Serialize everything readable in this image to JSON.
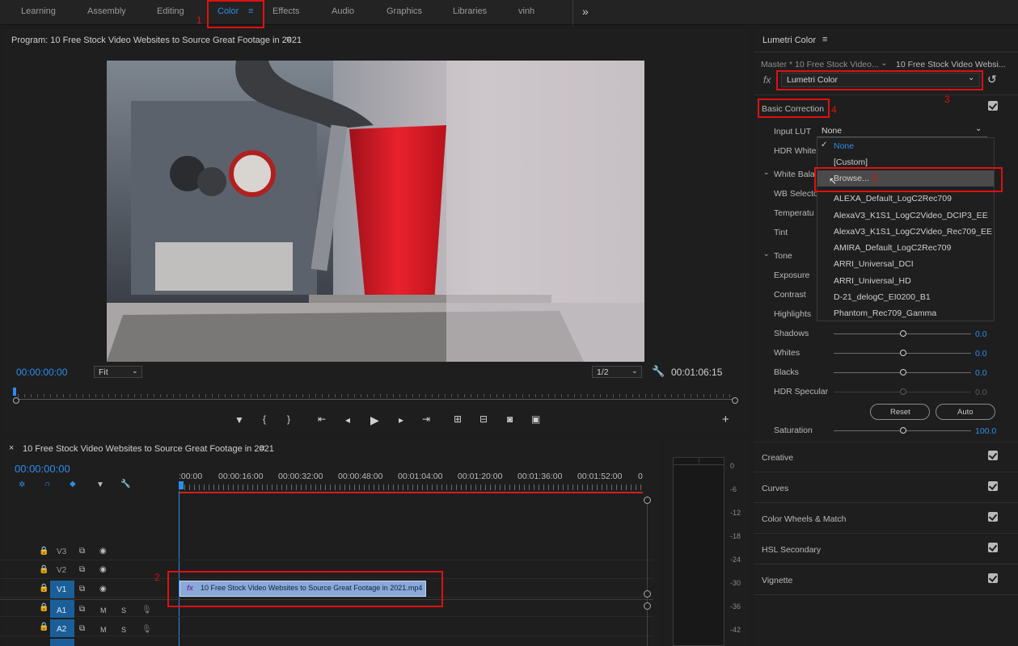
{
  "workspaces": [
    "Learning",
    "Assembly",
    "Editing",
    "Color",
    "Effects",
    "Audio",
    "Graphics",
    "Libraries",
    "vinh"
  ],
  "workspace_more": "»",
  "menu_glyph": "≡",
  "program": {
    "title": "Program: 10 Free Stock Video Websites to Source Great Footage in 2021",
    "timecode": "00:00:00:00",
    "fit": "Fit",
    "resolution": "1/2",
    "duration": "00:01:06:15"
  },
  "timeline": {
    "close": "×",
    "title": "10 Free Stock Video Websites to Source Great Footage in 2021",
    "timecode": "00:00:00:00",
    "ruler": [
      ":00:00",
      "00:00:16:00",
      "00:00:32:00",
      "00:00:48:00",
      "00:01:04:00",
      "00:01:20:00",
      "00:01:36:00",
      "00:01:52:00",
      "0"
    ],
    "tracks": [
      "V3",
      "V2",
      "V1",
      "A1",
      "A2"
    ],
    "mute": "M",
    "solo": "S",
    "clip_label": "10 Free Stock Video Websites to Source Great Footage in 2021.mp4",
    "fx": "fx"
  },
  "meter_ticks": [
    "0",
    "-6",
    "-12",
    "-18",
    "-24",
    "-30",
    "-36",
    "-42"
  ],
  "lumetri": {
    "panel_title": "Lumetri Color",
    "master": "Master * 10 Free Stock Video...",
    "sequence": "10 Free Stock Video Websi...",
    "fx": "fx",
    "effect": "Lumetri Color",
    "basic_correction": "Basic Correction",
    "input_lut_label": "Input LUT",
    "input_lut_value": "None",
    "hdr_white": "HDR White",
    "white_balance": "White Bala",
    "wb_selector": "WB Selecto",
    "temperature": "Temperatu",
    "tint": "Tint",
    "tone": "Tone",
    "exposure": "Exposure",
    "contrast": "Contrast",
    "highlights": "Highlights",
    "shadows": "Shadows",
    "whites": "Whites",
    "blacks": "Blacks",
    "hdr_specular": "HDR Specular",
    "zero": "0.0",
    "reset": "Reset",
    "auto": "Auto",
    "saturation": "Saturation",
    "saturation_value": "100.0",
    "sections": [
      "Creative",
      "Curves",
      "Color Wheels & Match",
      "HSL Secondary",
      "Vignette"
    ]
  },
  "lut_menu": [
    "None",
    "[Custom]",
    "Browse...",
    "ALEXA_Default_LogC2Rec709",
    "AlexaV3_K1S1_LogC2Video_DCIP3_EE",
    "AlexaV3_K1S1_LogC2Video_Rec709_EE",
    "AMIRA_Default_LogC2Rec709",
    "ARRI_Universal_DCI",
    "ARRI_Universal_HD",
    "D-21_delogC_EI0200_B1",
    "Phantom_Rec709_Gamma"
  ],
  "annotations": [
    "1",
    "2",
    "3",
    "4",
    "5"
  ],
  "colors": {
    "accent": "#2d8ceb",
    "highlight": "#e01010",
    "clip": "#8aa9d8"
  }
}
